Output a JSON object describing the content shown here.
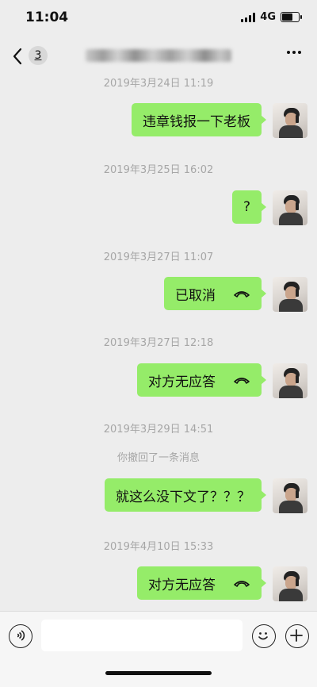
{
  "status_bar": {
    "time": "11:04",
    "network": "4G"
  },
  "nav": {
    "unread_count": "3"
  },
  "messages": [
    {
      "timestamp": "2019年3月24日 11:19",
      "text": "违章钱报一下老板",
      "call": false
    },
    {
      "timestamp": "2019年3月25日 16:02",
      "text": "?",
      "call": false
    },
    {
      "timestamp": "2019年3月27日 11:07",
      "text": "已取消",
      "call": true
    },
    {
      "timestamp": "2019年3月27日 12:18",
      "text": "对方无应答",
      "call": true
    },
    {
      "timestamp": "2019年3月29日 14:51",
      "system": "你撤回了一条消息",
      "text": "就这么没下文了？？？",
      "call": false
    },
    {
      "timestamp": "2019年4月10日 15:33",
      "text": "对方无应答",
      "call": true
    }
  ],
  "input": {
    "value": "",
    "placeholder": ""
  },
  "icons": {
    "back": "chevron-left-icon",
    "more": "more-dots-icon",
    "voice": "voice-icon",
    "emoji": "emoji-icon",
    "plus": "plus-icon",
    "call": "phone-hangup-icon"
  },
  "colors": {
    "bubble": "#95ec69",
    "background": "#ededed"
  }
}
